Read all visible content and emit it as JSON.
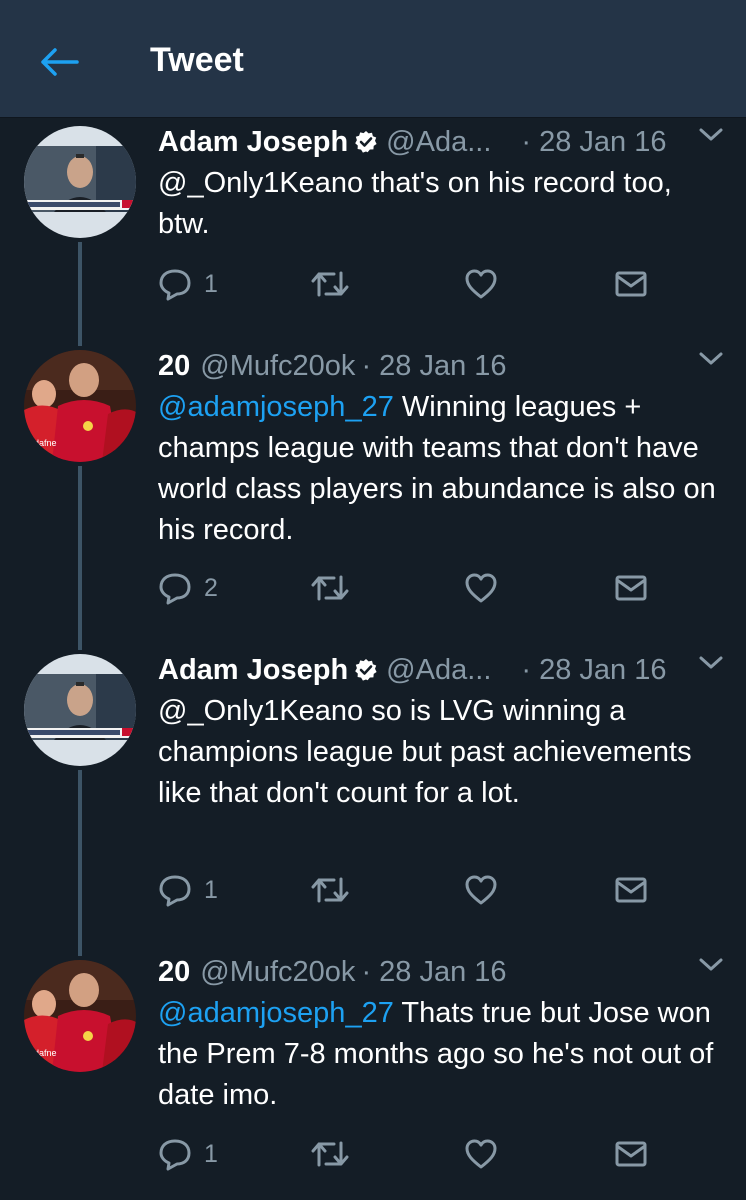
{
  "header": {
    "title": "Tweet"
  },
  "tweets": [
    {
      "name": "Adam Joseph",
      "verified": true,
      "handle": "@Ada...",
      "date": "· 28 Jan 16",
      "mention": "",
      "text": "@_Only1Keano that's on his record too, btw.",
      "reply_count": "1"
    },
    {
      "name": "20",
      "verified": false,
      "handle": "@Mufc20ok",
      "date": "· 28 Jan 16",
      "mention": "@adamjoseph_27",
      "text": " Winning leagues + champs league with teams that don't have world class players in abundance is also on his record.",
      "reply_count": "2"
    },
    {
      "name": "Adam Joseph",
      "verified": true,
      "handle": "@Ada...",
      "date": "· 28 Jan 16",
      "mention": "",
      "text": "@_Only1Keano so is LVG winning a champions league but past achievements like that don't count for a lot.",
      "reply_count": "1"
    },
    {
      "name": "20",
      "verified": false,
      "handle": "@Mufc20ok",
      "date": "· 28 Jan 16",
      "mention": "@adamjoseph_27",
      "text": " Thats true but Jose won the Prem 7-8 months ago so he's not out of date imo.",
      "reply_count": "1"
    }
  ],
  "icons": {
    "back": "arrow-left-icon",
    "verified": "verified-badge-icon",
    "caret": "chevron-down-icon",
    "reply": "reply-icon",
    "retweet": "retweet-icon",
    "like": "heart-icon",
    "dm": "envelope-icon"
  },
  "colors": {
    "background": "#141d26",
    "header": "#243447",
    "accent": "#1da1f2",
    "muted": "#8899a6",
    "thread_line": "#3d5466"
  }
}
